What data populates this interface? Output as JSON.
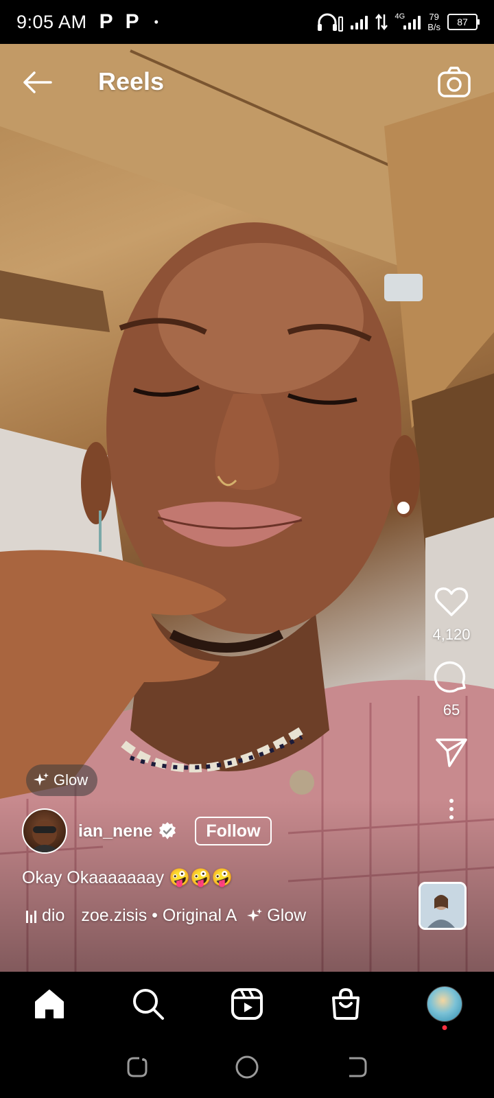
{
  "status_bar": {
    "time": "9:05 AM",
    "app_icon_1": "P",
    "app_icon_2": "P",
    "dot": "•",
    "network": "4G",
    "speed_value": "79",
    "speed_unit": "B/s",
    "battery": "87"
  },
  "header": {
    "title": "Reels",
    "back_icon": "arrow-left-icon",
    "camera_icon": "camera-icon"
  },
  "reel": {
    "effect_label": "Glow",
    "username": "ian_nene",
    "verified": true,
    "follow_label": "Follow",
    "caption": "Okay Okaaaaaaay 🤪🤪🤪",
    "audio_prefix": "dio",
    "audio_text": "zoe.zisis • Original A",
    "audio_effect": "Glow",
    "likes": "4,120",
    "comments": "65"
  },
  "nav": {
    "items": [
      "home-icon",
      "search-icon",
      "reels-icon",
      "shop-icon",
      "profile-avatar"
    ]
  },
  "system_nav": {
    "items": [
      "recents-icon",
      "home-circle-icon",
      "back-icon"
    ]
  },
  "colors": {
    "accent_dot": "#ff3040",
    "background": "#000000"
  }
}
